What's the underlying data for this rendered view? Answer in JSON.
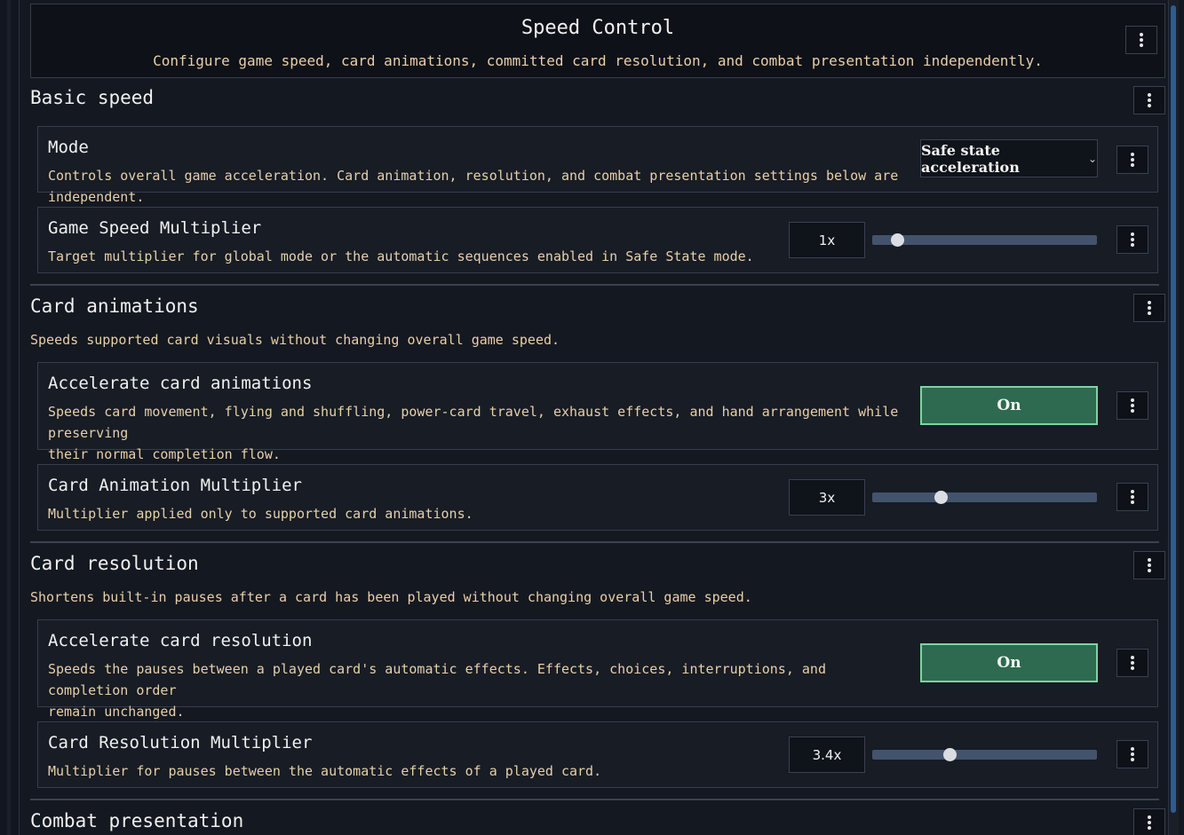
{
  "header": {
    "title": "Speed Control",
    "subtitle": "Configure game speed, card animations, committed card resolution, and combat presentation independently."
  },
  "sections": {
    "basic": {
      "title": "Basic speed",
      "mode": {
        "title": "Mode",
        "description": "Controls overall game acceleration. Card animation, resolution, and combat presentation settings below are independent.",
        "selected": "Safe state acceleration"
      },
      "multiplier": {
        "title": "Game Speed Multiplier",
        "description": "Target multiplier for global mode or the automatic sequences enabled in Safe State mode.",
        "value": "1x",
        "slider_fraction": 0.11
      }
    },
    "animations": {
      "title": "Card animations",
      "description": "Speeds supported card visuals without changing overall game speed.",
      "accelerate": {
        "title": "Accelerate card animations",
        "description_line1": "Speeds card movement, flying and shuffling, power-card travel, exhaust effects, and hand arrangement while preserving",
        "description_line2": "their normal completion flow.",
        "toggle": "On"
      },
      "multiplier": {
        "title": "Card Animation Multiplier",
        "description": "Multiplier applied only to supported card animations.",
        "value": "3x",
        "slider_fraction": 0.305
      }
    },
    "resolution": {
      "title": "Card resolution",
      "description": "Shortens built-in pauses after a card has been played without changing overall game speed.",
      "accelerate": {
        "title": "Accelerate card resolution",
        "description_line1": "Speeds the pauses between a played card's automatic effects. Effects, choices, interruptions, and completion order",
        "description_line2": "remain unchanged.",
        "toggle": "On"
      },
      "multiplier": {
        "title": "Card Resolution Multiplier",
        "description": "Multiplier for pauses between the automatic effects of a played card.",
        "value": "3.4x",
        "slider_fraction": 0.345
      }
    },
    "combat": {
      "title": "Combat presentation"
    }
  },
  "colors": {
    "background": "#141820",
    "card": "#171c25",
    "accent_text": "#e8cfa8",
    "toggle_on": "#2d6a4f",
    "toggle_border": "#7fd3a2",
    "slider_track": "#43536c"
  },
  "icons": {
    "menu": "more-vertical-icon",
    "chevron": "chevron-down-icon"
  }
}
